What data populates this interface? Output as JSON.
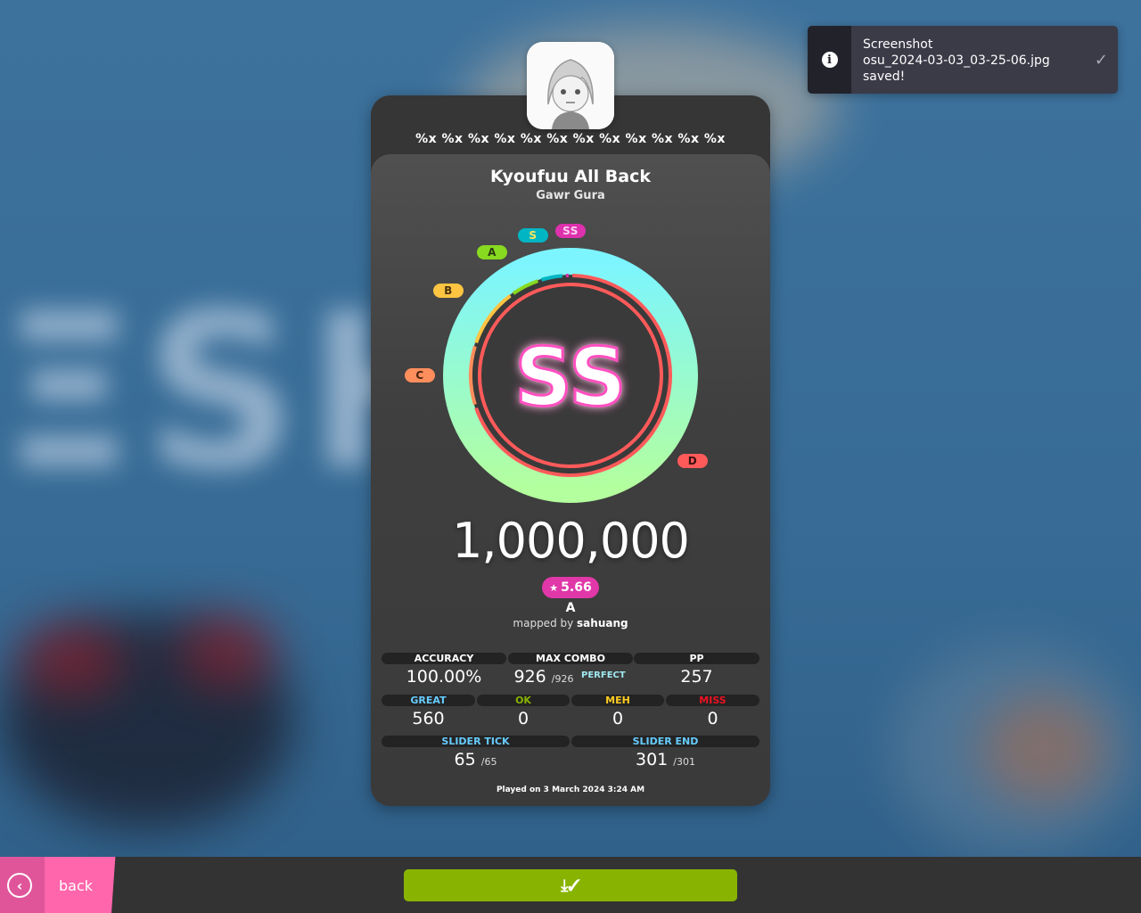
{
  "notification": {
    "line1": "Screenshot",
    "line2": "osu_2024-03-03_03-25-06.jpg",
    "line3": "saved!",
    "icon": "info-icon",
    "check_icon": "check-icon"
  },
  "player": {
    "username": "%x %x %x %x %x %x %x %x %x %x %x %x"
  },
  "beatmap": {
    "title": "Kyoufuu All Back",
    "artist": "Gawr Gura",
    "star_rating": "5.66",
    "difficulty": "A",
    "mapped_by_prefix": "mapped by ",
    "mapper": "sahuang"
  },
  "result": {
    "rank": "SS",
    "score": "1,000,000",
    "accuracy_fraction": 1.0
  },
  "grade_labels": [
    "D",
    "C",
    "B",
    "A",
    "S",
    "SS"
  ],
  "colors": {
    "D": "#ff5a5a",
    "C": "#ff8e5d",
    "B": "#ffc442",
    "A": "#88da20",
    "S": "#02b5c3",
    "SS": "#de31ae",
    "accent_pink": "#ff66ab",
    "download_green": "#88b300"
  },
  "stats": {
    "accuracy": {
      "label": "ACCURACY",
      "value": "100.00%"
    },
    "max_combo": {
      "label": "MAX COMBO",
      "value": "926",
      "max": "/926",
      "badge": "PERFECT"
    },
    "pp": {
      "label": "PP",
      "value": "257"
    },
    "great": {
      "label": "GREAT",
      "value": "560"
    },
    "ok": {
      "label": "OK",
      "value": "0"
    },
    "meh": {
      "label": "MEH",
      "value": "0"
    },
    "miss": {
      "label": "MISS",
      "value": "0"
    },
    "slider_tick": {
      "label": "SLIDER TICK",
      "value": "65",
      "max": "/65"
    },
    "slider_end": {
      "label": "SLIDER END",
      "value": "301",
      "max": "/301"
    }
  },
  "played_on": "Played on 3 March 2024 3:24 AM",
  "footer": {
    "back_label": "back",
    "download_icon": "download-icon",
    "back_icon": "chevron-left-icon"
  }
}
